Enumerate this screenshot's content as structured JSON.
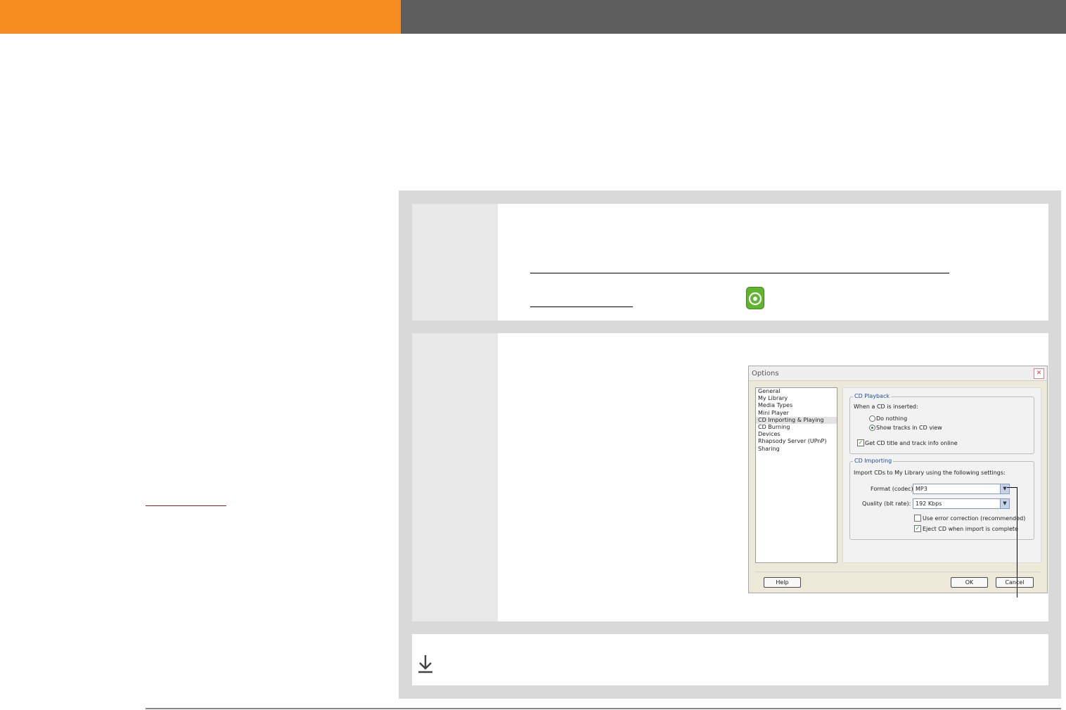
{
  "dialog": {
    "title": "Options",
    "close": "✕",
    "categories": [
      "General",
      "My Library",
      "Media Types",
      "Mini Player",
      "CD Importing & Playing",
      "CD Burning",
      "Devices",
      "Rhapsody Server (UPnP)",
      "Sharing"
    ],
    "selected_category": "CD Importing & Playing",
    "playback": {
      "group": "CD Playback",
      "prompt": "When a CD is inserted:",
      "do_nothing": "Do nothing",
      "show_tracks": "Show tracks in CD view",
      "show_tracks_selected": true,
      "get_info": "Get CD title and track info online",
      "get_info_checked": true
    },
    "importing": {
      "group": "CD Importing",
      "prompt": "Import CDs to My Library using the following settings:",
      "format_label": "Format (codec):",
      "format_value": "MP3",
      "quality_label": "Quality (bit rate):",
      "quality_value": "192 Kbps",
      "error_correction": "Use error correction (recommended)",
      "error_correction_checked": false,
      "eject": "Eject CD when import is complete",
      "eject_checked": true
    },
    "help_button": "Help",
    "ok_button": "OK",
    "cancel_button": "Cancel"
  },
  "colors": {
    "header_orange": "#f68b1f",
    "header_gray": "#5d5d5d",
    "panel_gray": "#d9d9d9",
    "cd_icon_green": "#5fb62e"
  },
  "icons": {
    "cd": "cd-icon",
    "tip": "download-arrow-icon"
  }
}
